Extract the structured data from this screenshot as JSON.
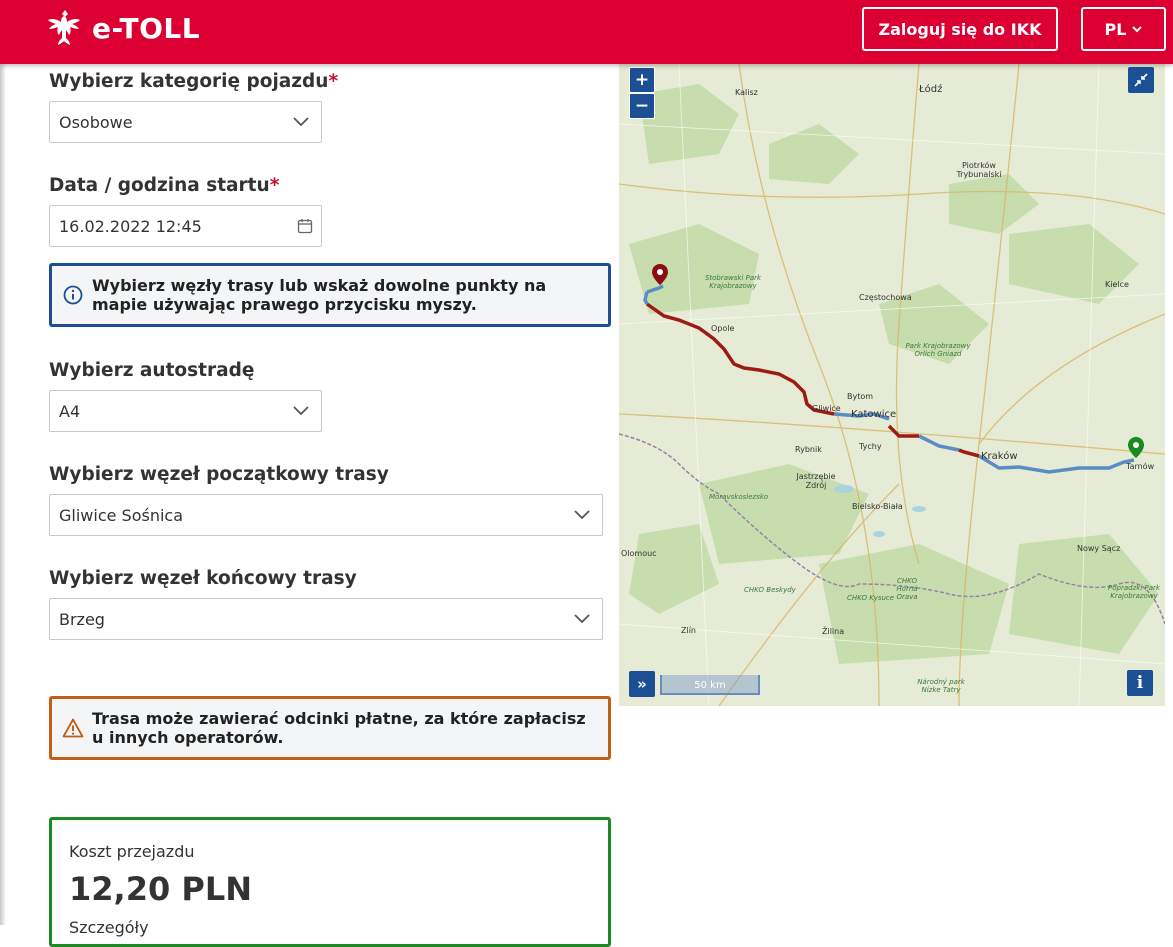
{
  "header": {
    "logo_text": "e-TOLL",
    "login_button": "Zaloguj się do IKK",
    "lang_button": "PL"
  },
  "form": {
    "vehicle_category": {
      "label": "Wybierz kategorię pojazdu",
      "required_mark": "*",
      "value": "Osobowe"
    },
    "start_datetime": {
      "label": "Data / godzina startu",
      "required_mark": "*",
      "value": "16.02.2022 12:45"
    },
    "info_alert": "Wybierz węzły trasy lub wskaż dowolne punkty na mapie używając prawego przycisku myszy.",
    "motorway": {
      "label": "Wybierz autostradę",
      "value": "A4"
    },
    "start_node": {
      "label": "Wybierz węzeł początkowy trasy",
      "value": "Gliwice Sośnica"
    },
    "end_node": {
      "label": "Wybierz węzeł końcowy trasy",
      "value": "Brzeg"
    },
    "warning_alert": "Trasa może zawierać odcinki płatne, za które zapłacisz u innych operatorów."
  },
  "cost": {
    "label": "Koszt przejazdu",
    "value": "12,20 PLN",
    "details": "Szczegóły"
  },
  "map": {
    "zoom_in": "+",
    "zoom_out": "−",
    "layers_button": "»",
    "info_button": "i",
    "scale_label": "50 km",
    "cities": {
      "kalisz": "Kalisz",
      "lodz": "Łódź",
      "piotrkow": "Piotrków Trybunalski",
      "czestochowa": "Częstochowa",
      "opole": "Opole",
      "kielce": "Kielce",
      "bytom": "Bytom",
      "gliwice": "Gliwice",
      "katowice": "Katowice",
      "rybnik": "Rybnik",
      "tychy": "Tychy",
      "krakow": "Kraków",
      "tarnow": "Tarnów",
      "jastrzebie": "Jastrzębie Zdrój",
      "bielsko": "Bielsko-Biała",
      "olomouc": "Olomouc",
      "nowysacz": "Nowy Sącz",
      "zilina": "Žilina",
      "zlin": "Zlín"
    },
    "parks": {
      "stobrawski": "Stobrawski Park Krajobrazowy",
      "orlich": "Park Krajobrazowy Orlich Gniazd",
      "moravskoslezsko": "Moravskoslezsko",
      "beskydy": "CHKO Beskydy",
      "kysuce": "CHKO Kysuce",
      "horna_orava": "CHKO Horná Orava",
      "popradzki": "Popradzki Park Krajobrazowy",
      "narodny": "Národný park Nízke Tatry"
    }
  },
  "colors": {
    "header_red": "#dc0032",
    "info_blue": "#1c4f93",
    "warning_orange": "#c05f15",
    "cost_green": "#1b8a22",
    "route_toll": "#9e1a14",
    "route_other": "#5b8cc4"
  }
}
